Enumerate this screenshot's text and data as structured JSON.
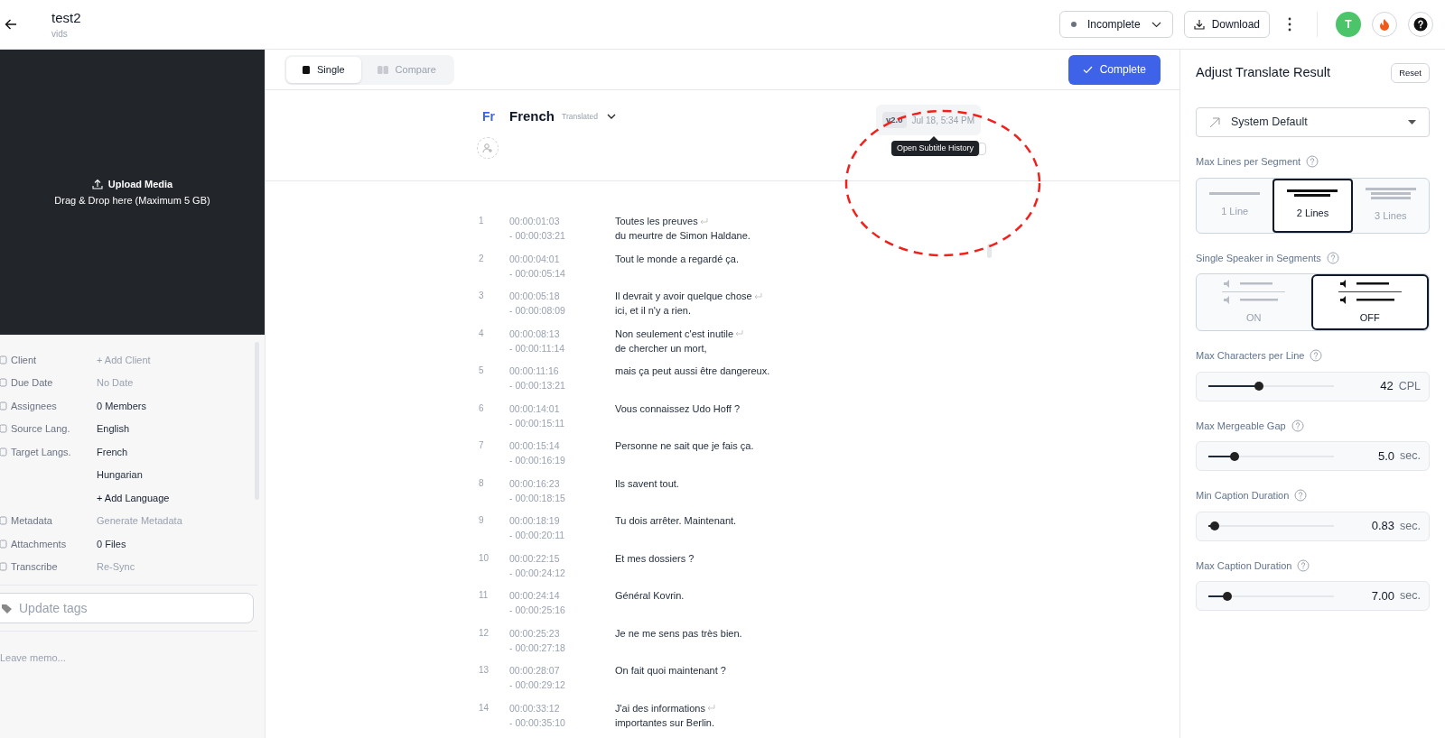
{
  "header": {
    "title": "test2",
    "subtitle": "vids",
    "status": "Incomplete",
    "download": "Download",
    "avatar": "T"
  },
  "sidebar": {
    "upload_title": "Upload Media",
    "upload_hint": "Drag & Drop here (Maximum 5 GB)",
    "fields": [
      {
        "label": "Client",
        "values": [
          {
            "text": "+ Add Client",
            "kind": "muted"
          }
        ]
      },
      {
        "label": "Due Date",
        "values": [
          {
            "text": "No Date",
            "kind": "muted"
          }
        ]
      },
      {
        "label": "Assignees",
        "values": [
          {
            "text": "0 Members",
            "kind": "normal"
          }
        ]
      },
      {
        "label": "Source Lang.",
        "values": [
          {
            "text": "English",
            "kind": "normal"
          }
        ]
      },
      {
        "label": "Target Langs.",
        "values": [
          {
            "text": "French",
            "kind": "normal"
          },
          {
            "text": "Hungarian",
            "kind": "normal"
          },
          {
            "text": "+ Add Language",
            "kind": "bold"
          }
        ]
      },
      {
        "label": "Metadata",
        "values": [
          {
            "text": "Generate Metadata",
            "kind": "muted"
          }
        ]
      },
      {
        "label": "Attachments",
        "values": [
          {
            "text": "0 Files",
            "kind": "normal"
          }
        ]
      },
      {
        "label": "Transcribe",
        "values": [
          {
            "text": "Re-Sync",
            "kind": "muted"
          }
        ]
      }
    ],
    "tags_placeholder": "Update tags",
    "memo_placeholder": "Leave memo..."
  },
  "view_tabs": [
    {
      "label": "Single",
      "selected": true
    },
    {
      "label": "Compare",
      "selected": false
    }
  ],
  "complete_button": "Complete",
  "language": {
    "code": "Fr",
    "name": "French",
    "status": "Translated"
  },
  "version": {
    "badge": "v2.0",
    "date": "Jul 18, 5:34 PM"
  },
  "tooltip": "Open Subtitle History",
  "segments": [
    {
      "index": "1",
      "start": "00:00:01:03",
      "end": "- 00:00:03:21",
      "lines": [
        "Toutes les preuves",
        "du meurtre de Simon Haldane."
      ]
    },
    {
      "index": "2",
      "start": "00:00:04:01",
      "end": "- 00:00:05:14",
      "lines": [
        "Tout le monde a regardé ça."
      ]
    },
    {
      "index": "3",
      "start": "00:00:05:18",
      "end": "- 00:00:08:09",
      "lines": [
        "Il devrait y avoir quelque chose",
        "ici, et il n'y a rien."
      ]
    },
    {
      "index": "4",
      "start": "00:00:08:13",
      "end": "- 00:00:11:14",
      "lines": [
        "Non seulement c'est inutile",
        "de chercher un mort,"
      ]
    },
    {
      "index": "5",
      "start": "00:00:11:16",
      "end": "- 00:00:13:21",
      "lines": [
        "mais ça peut aussi être dangereux."
      ]
    },
    {
      "index": "6",
      "start": "00:00:14:01",
      "end": "- 00:00:15:11",
      "lines": [
        "Vous connaissez Udo Hoff ?"
      ]
    },
    {
      "index": "7",
      "start": "00:00:15:14",
      "end": "- 00:00:16:19",
      "lines": [
        "Personne ne sait que je fais ça."
      ]
    },
    {
      "index": "8",
      "start": "00:00:16:23",
      "end": "- 00:00:18:15",
      "lines": [
        "Ils savent tout."
      ]
    },
    {
      "index": "9",
      "start": "00:00:18:19",
      "end": "- 00:00:20:11",
      "lines": [
        "Tu dois arrêter. Maintenant."
      ]
    },
    {
      "index": "10",
      "start": "00:00:22:15",
      "end": "- 00:00:24:12",
      "lines": [
        "Et mes dossiers ?"
      ]
    },
    {
      "index": "11",
      "start": "00:00:24:14",
      "end": "- 00:00:25:16",
      "lines": [
        "Général Kovrin."
      ]
    },
    {
      "index": "12",
      "start": "00:00:25:23",
      "end": "- 00:00:27:18",
      "lines": [
        "Je ne me sens pas très bien."
      ]
    },
    {
      "index": "13",
      "start": "00:00:28:07",
      "end": "- 00:00:29:12",
      "lines": [
        "On fait quoi maintenant ?"
      ]
    },
    {
      "index": "14",
      "start": "00:00:33:12",
      "end": "- 00:00:35:10",
      "lines": [
        "J'ai des informations",
        "importantes sur Berlin."
      ]
    }
  ],
  "settings": {
    "title": "Adjust Translate Result",
    "reset": "Reset",
    "preset": "System Default",
    "max_lines": {
      "label": "Max Lines per Segment",
      "options": [
        {
          "label": "1 Line",
          "selected": false
        },
        {
          "label": "2 Lines",
          "selected": true
        },
        {
          "label": "3 Lines",
          "selected": false
        }
      ]
    },
    "speaker": {
      "label": "Single Speaker in Segments",
      "options": [
        {
          "label": "ON",
          "selected": false
        },
        {
          "label": "OFF",
          "selected": true
        }
      ]
    },
    "sliders": [
      {
        "label": "Max Characters per Line",
        "value": "42",
        "unit": "CPL",
        "level": 0.4
      },
      {
        "label": "Max Mergeable Gap",
        "value": "5.0",
        "unit": "sec.",
        "level": 0.21
      },
      {
        "label": "Min Caption Duration",
        "value": "0.83",
        "unit": "sec.",
        "level": 0.05
      },
      {
        "label": "Max Caption Duration",
        "value": "7.00",
        "unit": "sec.",
        "level": 0.15
      }
    ]
  }
}
